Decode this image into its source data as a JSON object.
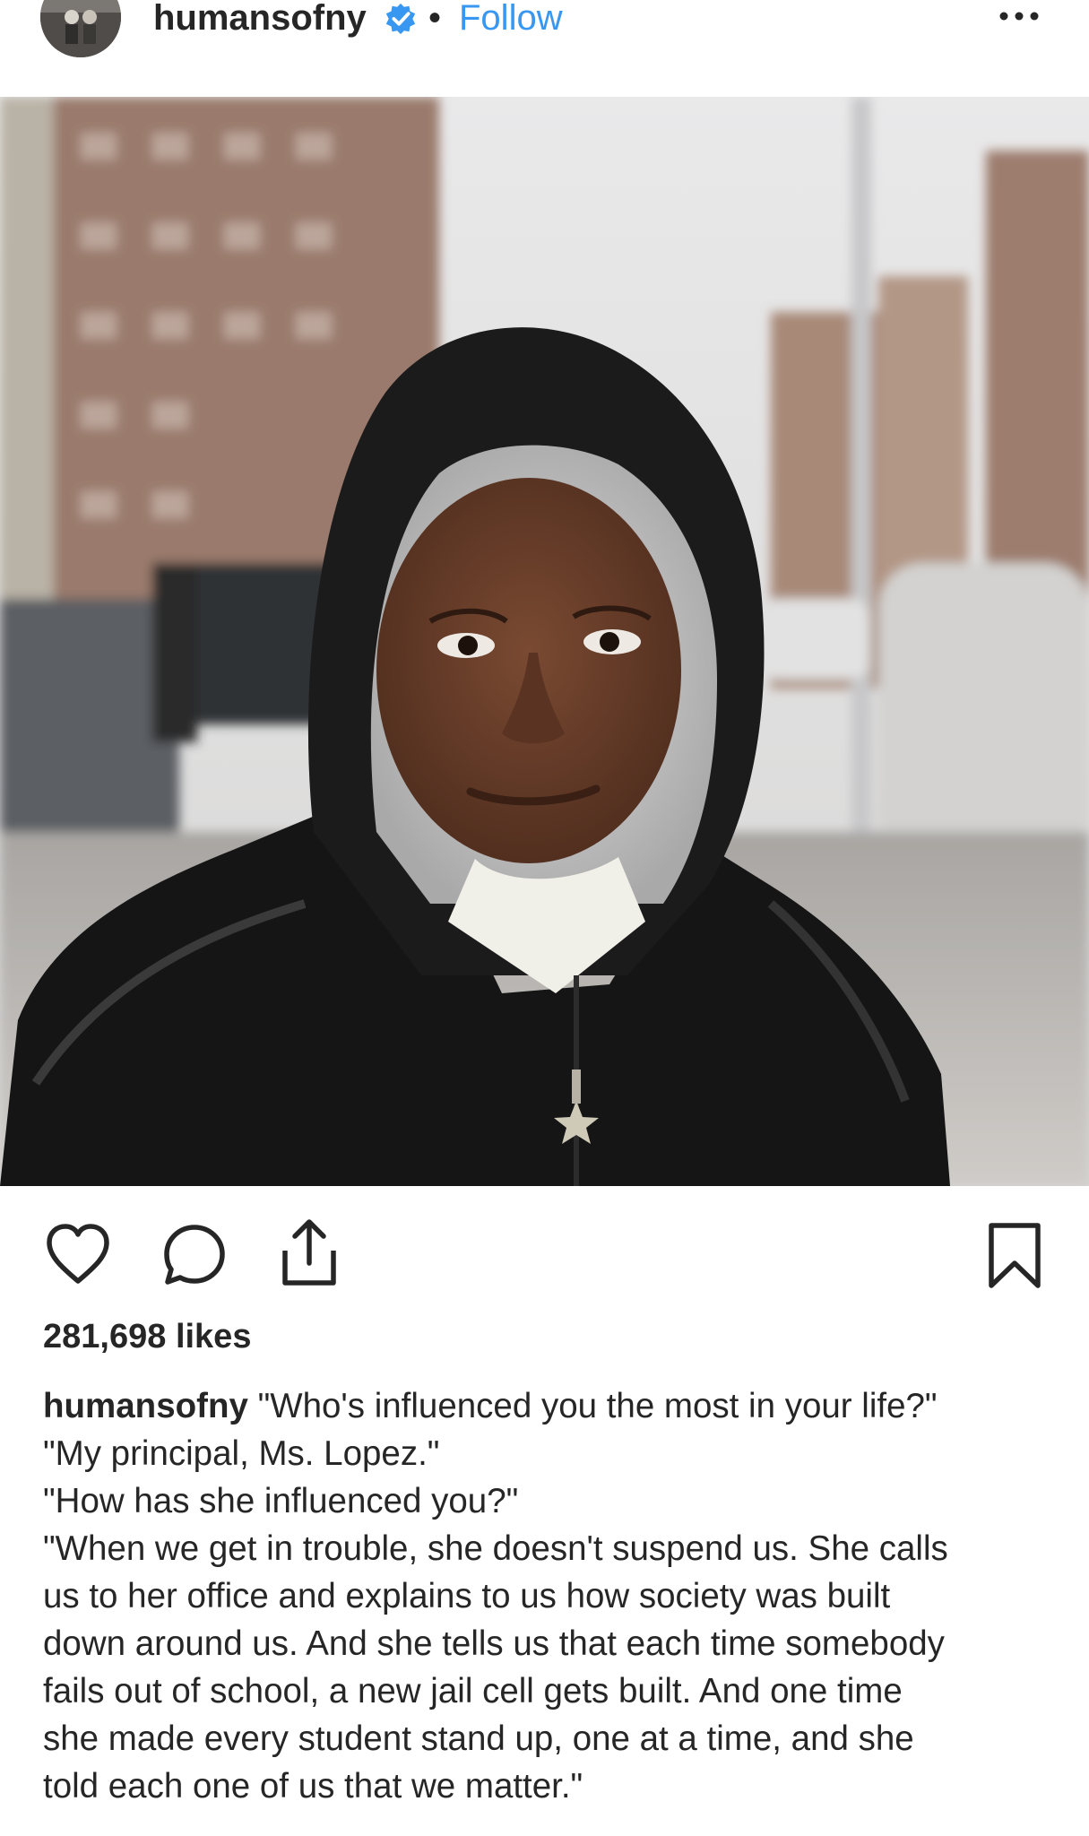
{
  "header": {
    "username": "humansofny",
    "separator": "•",
    "follow_label": "Follow",
    "avatar_icon": "avatar-photo",
    "verified_icon": "verified-badge-icon",
    "more_icon": "more-options-icon"
  },
  "post": {
    "image_subject": "street-portrait-photo"
  },
  "actions": {
    "like_icon": "heart-icon",
    "comment_icon": "comment-icon",
    "share_icon": "share-icon",
    "save_icon": "bookmark-icon"
  },
  "likes": {
    "count": "281,698",
    "label": "likes"
  },
  "caption": {
    "username": "humansofny",
    "lines": [
      "\"Who's influenced you the most in your life?\"",
      "\"My principal, Ms. Lopez.\"",
      "\"How has she influenced you?\"",
      "\"When we get in trouble, she doesn't suspend us. She calls",
      "us to her office and explains to us how society was built",
      "down around us. And she tells us that each time somebody",
      "fails out of school, a new jail cell gets built. And one time",
      "she made every student stand up, one at a time, and she",
      "told each one of us that we matter.\""
    ]
  },
  "colors": {
    "link": "#3897f0",
    "text": "#262626",
    "verified": "#3897f0"
  }
}
